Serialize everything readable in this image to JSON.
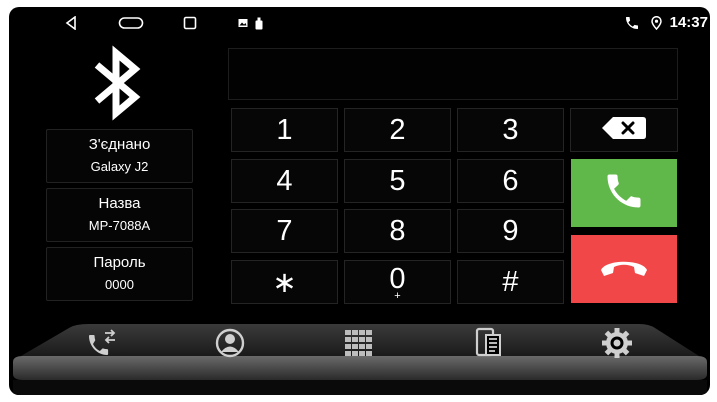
{
  "status_bar": {
    "nav_icons": [
      "back-icon",
      "home-icon",
      "recents-icon"
    ],
    "notification_icons": [
      "image-icon",
      "usb-icon"
    ],
    "right_icons": [
      "phone-icon",
      "location-pin-icon"
    ],
    "time": "14:37"
  },
  "bluetooth": {
    "icon": "bluetooth-icon",
    "connection_label": "З'єднано",
    "device_name": "Galaxy J2",
    "name_label": "Назва",
    "name_value": "MP-7088A",
    "password_label": "Пароль",
    "password_value": "0000"
  },
  "dialer": {
    "display_value": "",
    "keys": [
      {
        "label": "1",
        "sub": ""
      },
      {
        "label": "2",
        "sub": ""
      },
      {
        "label": "3",
        "sub": ""
      },
      {
        "label": "4",
        "sub": ""
      },
      {
        "label": "5",
        "sub": ""
      },
      {
        "label": "6",
        "sub": ""
      },
      {
        "label": "7",
        "sub": ""
      },
      {
        "label": "8",
        "sub": ""
      },
      {
        "label": "9",
        "sub": ""
      },
      {
        "label": "∗",
        "sub": ""
      },
      {
        "label": "0",
        "sub": "+"
      },
      {
        "label": "#",
        "sub": ""
      }
    ],
    "backspace_icon": "backspace-icon",
    "call_icon": "phone-call-icon",
    "end_call_icon": "phone-hangup-icon",
    "call_color": "#61b84a",
    "end_call_color": "#f24748"
  },
  "dock": {
    "items": [
      {
        "icon": "call-log-icon",
        "active": false
      },
      {
        "icon": "contacts-icon",
        "active": false
      },
      {
        "icon": "dialpad-icon",
        "active": true
      },
      {
        "icon": "phonebook-icon",
        "active": false
      },
      {
        "icon": "settings-icon",
        "active": false
      }
    ]
  }
}
